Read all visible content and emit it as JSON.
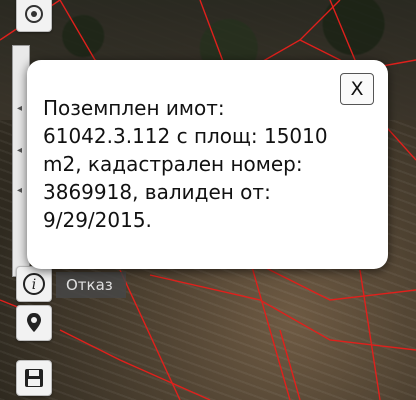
{
  "popup": {
    "text": "Поземплен имот:\n61042.3.112 с площ: 15010\nm2, кадастрален номер:\n3869918, валиден от:\n9/29/2015.",
    "close_label": "X"
  },
  "toolbar": {
    "cancel_label": "Отказ",
    "items": [
      {
        "icon": "locate-target-icon"
      },
      {
        "icon": "info-icon"
      },
      {
        "icon": "location-pin-icon"
      },
      {
        "icon": "save-icon"
      }
    ]
  },
  "colors": {
    "parcel_border": "#e0201c",
    "popup_background": "#ffffff"
  }
}
